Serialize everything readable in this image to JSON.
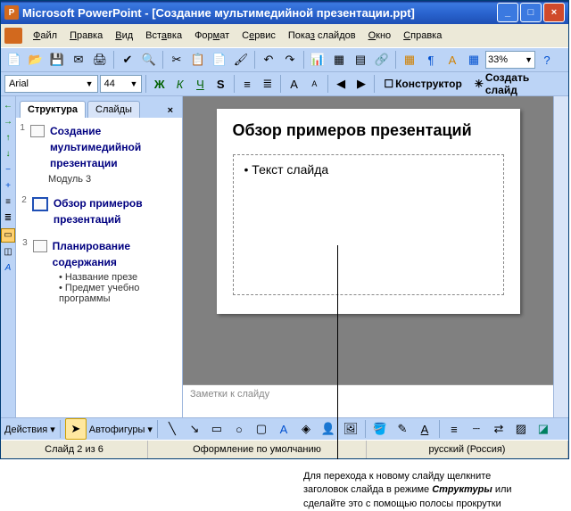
{
  "window": {
    "app": "Microsoft PowerPoint",
    "doc": "[Создание мультимедийной презентации.ppt]"
  },
  "menu": {
    "file": "Файл",
    "edit": "Правка",
    "view": "Вид",
    "insert": "Вставка",
    "format": "Формат",
    "tools": "Сервис",
    "slideshow": "Показ слайдов",
    "window": "Окно",
    "help": "Справка"
  },
  "toolbar": {
    "zoom": "33%",
    "font": "Arial",
    "size": "44",
    "designer": "Конструктор",
    "newslide": "Создать слайд"
  },
  "tabs": {
    "outline": "Структура",
    "slides": "Слайды"
  },
  "outline": {
    "s1": {
      "num": "1",
      "title": "Создание мультимедийной презентации",
      "sub": "Модуль 3"
    },
    "s2": {
      "num": "2",
      "title": "Обзор примеров презентаций"
    },
    "s3": {
      "num": "3",
      "title": "Планирование содержания",
      "b1": "Название презе",
      "b2": "Предмет учебно программы"
    }
  },
  "slide": {
    "title": "Обзор примеров презентаций",
    "body": "Текст слайда"
  },
  "notes": "Заметки к слайду",
  "draw": {
    "actions": "Действия",
    "shapes": "Автофигуры"
  },
  "status": {
    "slide": "Слайд 2 из 6",
    "design": "Оформление по умолчанию",
    "lang": "русский (Россия)"
  },
  "caption": {
    "l1": "Для перехода к новому слайду щелкните",
    "l2": "заголовок слайда в режиме ",
    "l2b": "Структуры",
    "l2c": " или",
    "l3": "сделайте это с помощью полосы прокрутки"
  }
}
